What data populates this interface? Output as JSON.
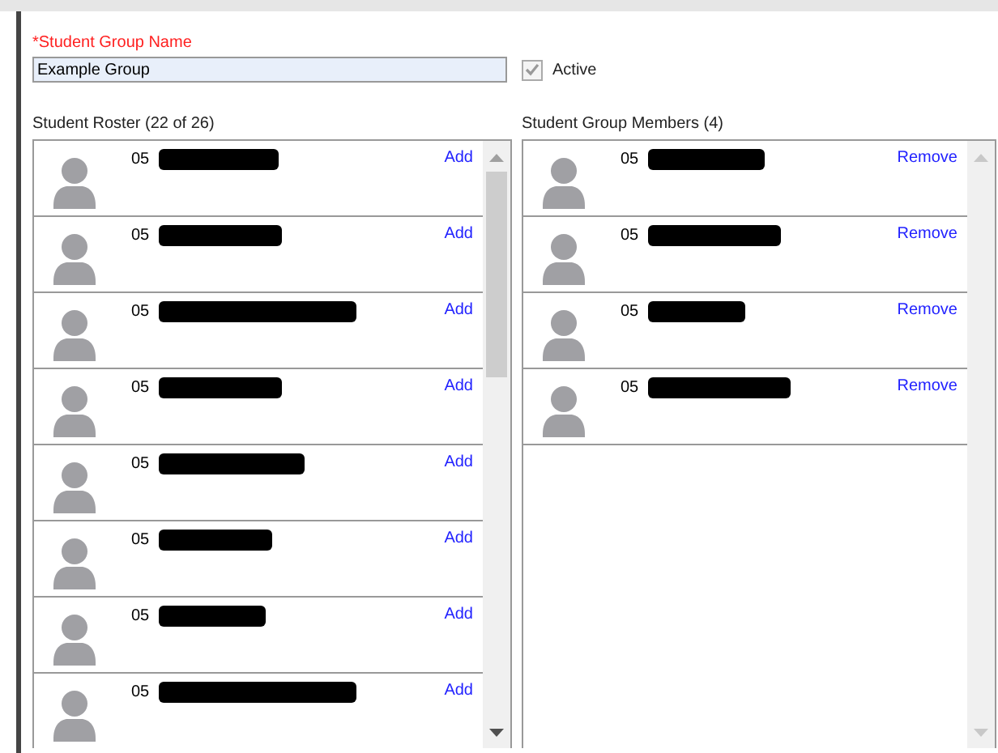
{
  "group_name": {
    "label": "*Student Group Name",
    "value": "Example Group"
  },
  "active": {
    "label": "Active",
    "checked": true
  },
  "roster": {
    "title": "Student Roster (22 of 26)",
    "rows": [
      {
        "grade": "05",
        "action": "Add"
      },
      {
        "grade": "05",
        "action": "Add"
      },
      {
        "grade": "05",
        "action": "Add"
      },
      {
        "grade": "05",
        "action": "Add"
      },
      {
        "grade": "05",
        "action": "Add"
      },
      {
        "grade": "05",
        "action": "Add"
      },
      {
        "grade": "05",
        "action": "Add"
      },
      {
        "grade": "05",
        "action": "Add"
      }
    ]
  },
  "members": {
    "title": "Student Group Members (4)",
    "rows": [
      {
        "grade": "05",
        "action": "Remove"
      },
      {
        "grade": "05",
        "action": "Remove"
      },
      {
        "grade": "05",
        "action": "Remove"
      },
      {
        "grade": "05",
        "action": "Remove"
      }
    ]
  }
}
